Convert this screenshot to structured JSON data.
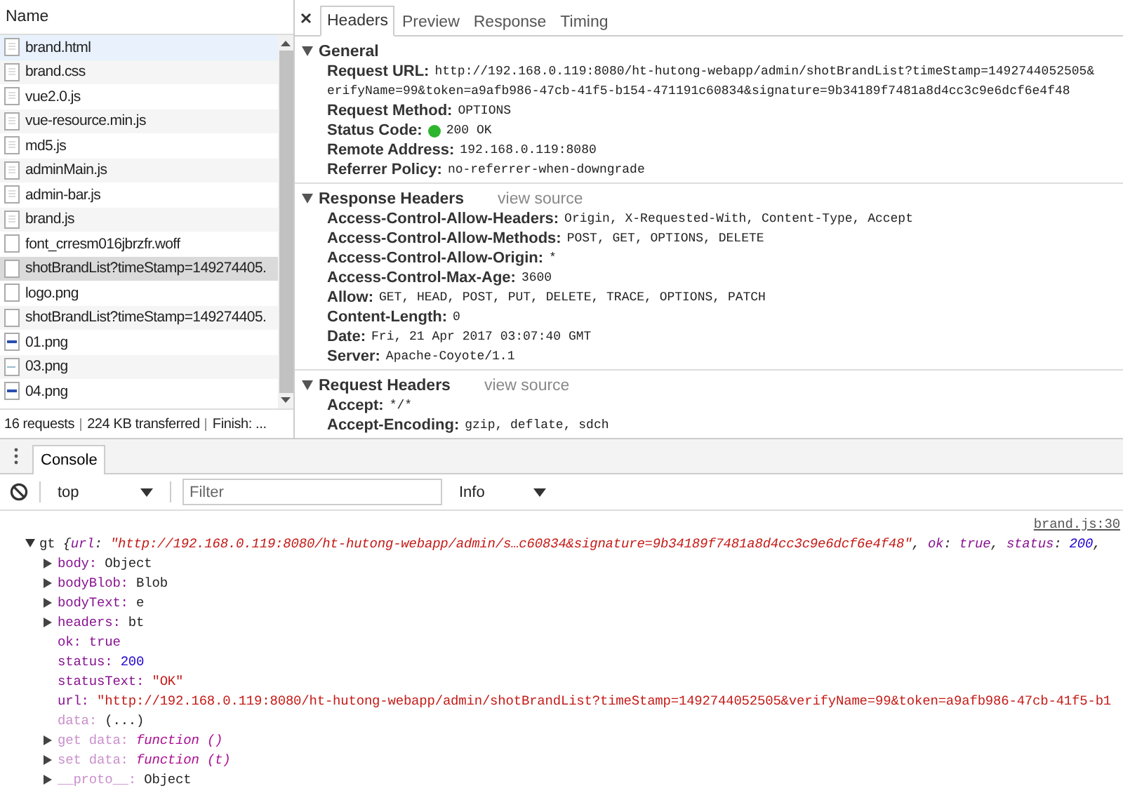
{
  "network": {
    "column_header": "Name",
    "requests": [
      {
        "name": "brand.html",
        "kind": "document",
        "selected": false,
        "hovered": true
      },
      {
        "name": "brand.css",
        "kind": "document",
        "selected": false,
        "hovered": false
      },
      {
        "name": "vue2.0.js",
        "kind": "document",
        "selected": false,
        "hovered": false
      },
      {
        "name": "vue-resource.min.js",
        "kind": "document",
        "selected": false,
        "hovered": false
      },
      {
        "name": "md5.js",
        "kind": "document",
        "selected": false,
        "hovered": false
      },
      {
        "name": "adminMain.js",
        "kind": "document",
        "selected": false,
        "hovered": false
      },
      {
        "name": "admin-bar.js",
        "kind": "document",
        "selected": false,
        "hovered": false
      },
      {
        "name": "brand.js",
        "kind": "document",
        "selected": false,
        "hovered": false
      },
      {
        "name": "font_crresm016jbrzfr.woff",
        "kind": "blank",
        "selected": false,
        "hovered": false
      },
      {
        "name": "shotBrandList?timeStamp=149274405.",
        "kind": "blank",
        "selected": true,
        "hovered": false
      },
      {
        "name": "logo.png",
        "kind": "blank",
        "selected": false,
        "hovered": false
      },
      {
        "name": "shotBrandList?timeStamp=149274405.",
        "kind": "blank",
        "selected": false,
        "hovered": false
      },
      {
        "name": "01.png",
        "kind": "image",
        "selected": false,
        "hovered": false
      },
      {
        "name": "03.png",
        "kind": "image-light",
        "selected": false,
        "hovered": false
      },
      {
        "name": "04.png",
        "kind": "image",
        "selected": false,
        "hovered": false
      }
    ],
    "status_bar": [
      "16 requests",
      "224 KB transferred",
      "Finish: ..."
    ]
  },
  "details": {
    "tabs": [
      {
        "label": "Headers",
        "selected": true
      },
      {
        "label": "Preview",
        "selected": false
      },
      {
        "label": "Response",
        "selected": false
      },
      {
        "label": "Timing",
        "selected": false
      }
    ],
    "sections": [
      {
        "title": "General",
        "expanded": true,
        "rows": [
          {
            "name": "Request URL:",
            "value_lines": [
              "http://192.168.0.119:8080/ht-hutong-webapp/admin/shotBrandList?timeStamp=1492744052505&",
              "erifyName=99&token=a9afb986-47cb-41f5-b154-471191c60834&signature=9b34189f7481a8d4cc3c9e6dcf6e4f48"
            ]
          },
          {
            "name": "Request Method:",
            "value_lines": [
              "OPTIONS"
            ]
          },
          {
            "name": "Status Code:",
            "value_lines": [
              "200 OK"
            ],
            "color": "#2db52d"
          },
          {
            "name": "Remote Address:",
            "value_lines": [
              "192.168.0.119:8080"
            ]
          },
          {
            "name": "Referrer Policy:",
            "value_lines": [
              "no-referrer-when-downgrade"
            ]
          }
        ]
      },
      {
        "title": "Response Headers",
        "link": "view source",
        "expanded": true,
        "rows": [
          {
            "name": "Access-Control-Allow-Headers:",
            "value_lines": [
              "Origin, X-Requested-With, Content-Type, Accept"
            ]
          },
          {
            "name": "Access-Control-Allow-Methods:",
            "value_lines": [
              "POST, GET, OPTIONS, DELETE"
            ]
          },
          {
            "name": "Access-Control-Allow-Origin:",
            "value_lines": [
              "*"
            ]
          },
          {
            "name": "Access-Control-Max-Age:",
            "value_lines": [
              "3600"
            ]
          },
          {
            "name": "Allow:",
            "value_lines": [
              "GET, HEAD, POST, PUT, DELETE, TRACE, OPTIONS, PATCH"
            ]
          },
          {
            "name": "Content-Length:",
            "value_lines": [
              "0"
            ]
          },
          {
            "name": "Date:",
            "value_lines": [
              "Fri, 21 Apr 2017 03:07:40 GMT"
            ]
          },
          {
            "name": "Server:",
            "value_lines": [
              "Apache-Coyote/1.1"
            ]
          }
        ]
      },
      {
        "title": "Request Headers",
        "link": "view source",
        "expanded": true,
        "rows": [
          {
            "name": "Accept:",
            "value_lines": [
              "*/*"
            ]
          },
          {
            "name": "Accept-Encoding:",
            "value_lines": [
              "gzip, deflate, sdch"
            ]
          }
        ]
      }
    ]
  },
  "console": {
    "tabs": [
      {
        "label": "Console",
        "selected": true
      }
    ],
    "context": "top",
    "filter": {
      "placeholder": "Filter"
    },
    "level": "Info",
    "source": "brand.js:30",
    "summary": {
      "expanded": true,
      "segments": [
        {
          "kind": "plain",
          "text": "gt "
        },
        {
          "kind": "italic",
          "text": "{"
        },
        {
          "kind": "key",
          "text": "url"
        },
        {
          "kind": "italic",
          "text": ": "
        },
        {
          "kind": "string",
          "text": "\"http://192.168.0.119:8080/ht-hutong-webapp/admin/s…c60834&signature=9b34189f7481a8d4cc3c9e6dcf6e4f48\""
        },
        {
          "kind": "italic",
          "text": ", "
        },
        {
          "kind": "key",
          "text": "ok"
        },
        {
          "kind": "italic",
          "text": ": "
        },
        {
          "kind": "keyword",
          "text": "true"
        },
        {
          "kind": "italic",
          "text": ", "
        },
        {
          "kind": "key",
          "text": "status"
        },
        {
          "kind": "italic",
          "text": ": "
        },
        {
          "kind": "number",
          "text": "200"
        },
        {
          "kind": "italic",
          "text": ","
        }
      ]
    },
    "properties": [
      {
        "key": "body:",
        "value": "Object",
        "kind": "plain",
        "expandable": true,
        "faded": false
      },
      {
        "key": "bodyBlob:",
        "value": "Blob",
        "kind": "plain",
        "expandable": true,
        "faded": false
      },
      {
        "key": "bodyText:",
        "value": "e",
        "kind": "plain",
        "expandable": true,
        "faded": false
      },
      {
        "key": "headers:",
        "value": "bt",
        "kind": "plain",
        "expandable": true,
        "faded": false
      },
      {
        "key": "ok:",
        "value": "true",
        "kind": "keyword",
        "expandable": false,
        "faded": false
      },
      {
        "key": "status:",
        "value": "200",
        "kind": "number",
        "expandable": false,
        "faded": false
      },
      {
        "key": "statusText:",
        "value": "\"OK\"",
        "kind": "string",
        "expandable": false,
        "faded": false
      },
      {
        "key": "url:",
        "value": "\"http://192.168.0.119:8080/ht-hutong-webapp/admin/shotBrandList?timeStamp=1492744052505&verifyName=99&token=a9afb986-47cb-41f5-b1",
        "kind": "string",
        "expandable": false,
        "faded": false
      },
      {
        "key": "data:",
        "value": "(...)",
        "kind": "plain",
        "expandable": false,
        "faded": true
      },
      {
        "key": "get data:",
        "value": "function ()",
        "kind": "function",
        "expandable": true,
        "faded": true
      },
      {
        "key": "set data:",
        "value": "function (t)",
        "kind": "function",
        "expandable": true,
        "faded": true
      },
      {
        "key": "__proto__:",
        "value": "Object",
        "kind": "plain",
        "expandable": true,
        "faded": true
      }
    ]
  }
}
